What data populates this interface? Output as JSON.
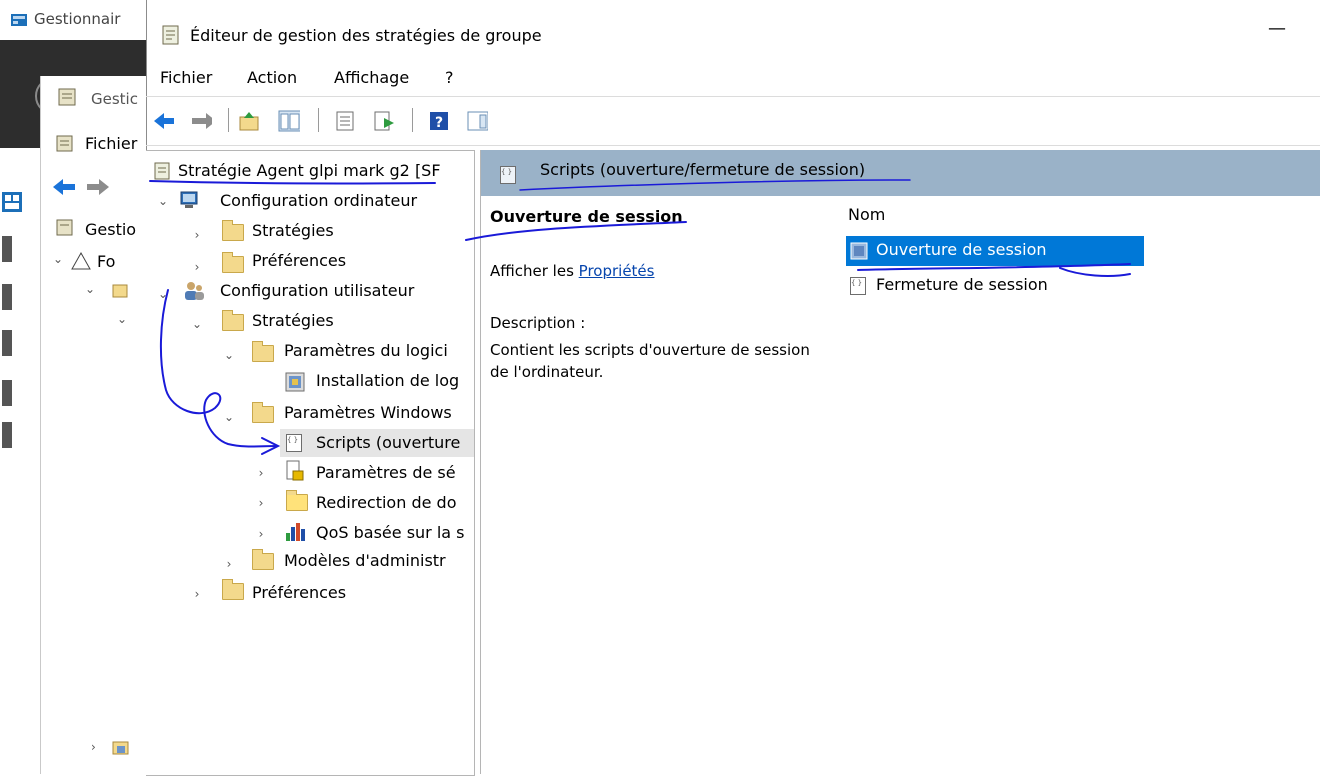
{
  "background_window": {
    "title": "Gestionnair",
    "inner_title": "Gestic",
    "menu_file": "Fichier",
    "tree_item1": "Gestio",
    "tree_item2": "Fo"
  },
  "window": {
    "title": "Éditeur de gestion des stratégies de groupe",
    "minimize_glyph": "—"
  },
  "menu": {
    "file": "Fichier",
    "action": "Action",
    "view": "Affichage",
    "help": "?"
  },
  "tree": {
    "root": "Stratégie Agent glpi mark g2 [SF",
    "computer_config": "Configuration ordinateur",
    "computer_strategies": "Stratégies",
    "computer_preferences": "Préférences",
    "user_config": "Configuration utilisateur",
    "user_strategies": "Stratégies",
    "software_settings": "Paramètres du logici",
    "software_install": "Installation de log",
    "windows_settings": "Paramètres Windows",
    "scripts": "Scripts (ouverture",
    "security_settings": "Paramètres de sé",
    "folder_redirection": "Redirection de do",
    "qos": "QoS basée sur la s",
    "admin_templates": "Modèles d'administr",
    "user_preferences": "Préférences"
  },
  "right_pane": {
    "header": "Scripts (ouverture/fermeture de session)",
    "title": "Ouverture de session",
    "show_prefix": "Afficher les ",
    "properties_link": "Propriétés",
    "description_label": "Description :",
    "description": "Contient les scripts d'ouverture de session de l'ordinateur.",
    "list_column": "Nom",
    "list_items": [
      "Ouverture de session",
      "Fermeture de session"
    ]
  },
  "colors": {
    "header_bg": "#9ab2c8",
    "selection": "#0078d7",
    "annotation": "#1a1ad8"
  }
}
